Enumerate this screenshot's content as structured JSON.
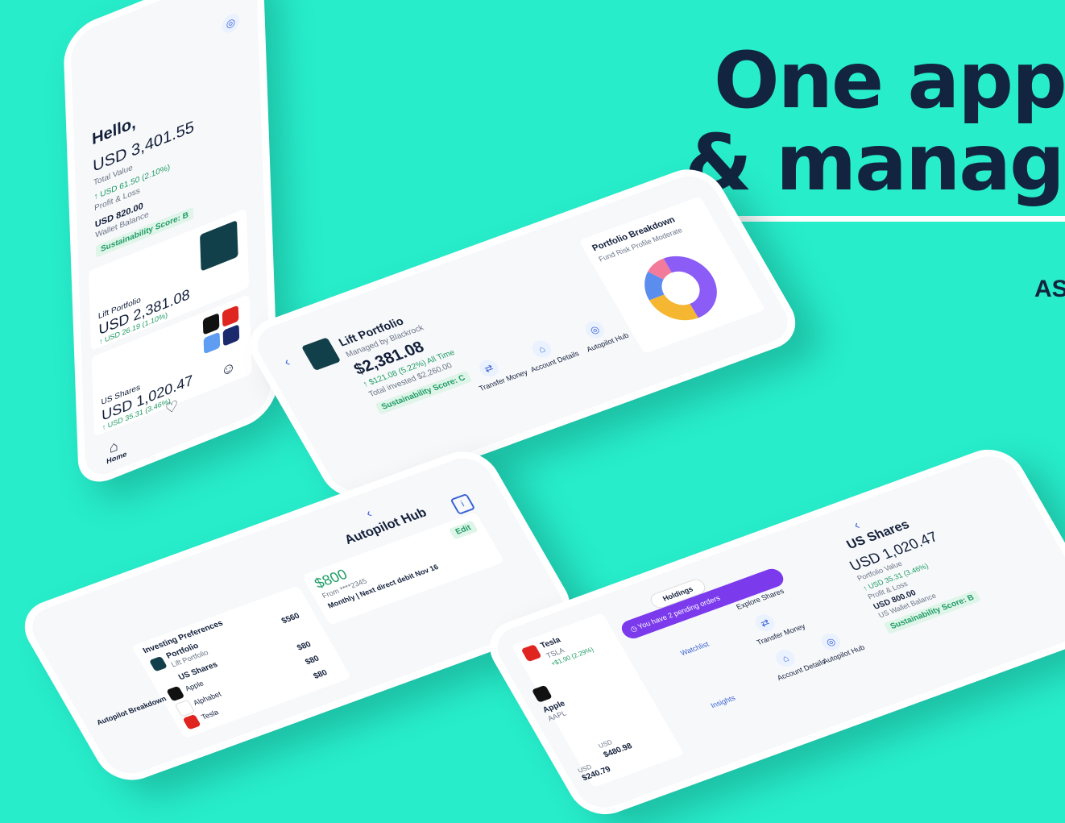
{
  "headline": {
    "line1": "One app",
    "line2": "& manag",
    "tag": "AS"
  },
  "home": {
    "app_icon": "autopilot-icon",
    "greeting": "Hello,",
    "total_value": "USD 3,401.55",
    "total_value_label": "Total Value",
    "pnl": "↑ USD 61.50 (2.10%)",
    "pnl_label": "Profit & Loss",
    "wallet": "USD 820.00",
    "wallet_label": "Wallet Balance",
    "score": "Sustainability Score: B",
    "lift_label": "Lift Portfolio",
    "lift_value": "USD 2,381.08",
    "lift_change": "↑ USD 26.19 (1.10%)",
    "us_label": "US Shares",
    "us_value": "USD 1,020.47",
    "us_change": "↑ USD 35.31 (3.46%)",
    "nav_home": "Home"
  },
  "lift": {
    "title": "Lift Portfolio",
    "managed": "Managed by Blackrock",
    "value": "$2,381.08",
    "all_time": "↑ $121.08 (5.22%) All Time",
    "invested": "Total invested $2,260.00",
    "score": "Sustainability Score: C",
    "actions": [
      "Transfer Money",
      "Account Details",
      "Autopilot Hub"
    ],
    "breakdown_title": "Portfolio Breakdown",
    "risk": "Fund Risk Profile Moderate",
    "colors": {
      "purple": "#8b5cf6",
      "yellow": "#f5b731",
      "blue": "#5b8def",
      "pink": "#f27a9a"
    }
  },
  "autopilot": {
    "title": "Autopilot Hub",
    "amount": "$800",
    "from": "From ****2345",
    "schedule": "Monthly | Next direct debit Nov 16",
    "edit": "Edit",
    "prefs_title": "Investing Preferences",
    "portfolio_label": "Portfolio",
    "lift": "Lift Portfolio",
    "lift_amt": "$560",
    "us_label": "US Shares",
    "apple": "Apple",
    "apple_amt": "$80",
    "alphabet": "Alphabet",
    "alphabet_amt": "$80",
    "tesla": "Tesla",
    "tesla_amt": "$80",
    "breakdown": "Autopilot Breakdown"
  },
  "usshares": {
    "title": "US Shares",
    "value": "USD 1,020.47",
    "value_label": "Portfolio Value",
    "pnl": "↑ USD 35.31 (3.46%)",
    "pnl_label": "Profit & Loss",
    "wallet": "USD 800.00",
    "wallet_label": "US Wallet Balance",
    "score": "Sustainability Score: B",
    "actions": [
      "Explore Shares",
      "Transfer Money",
      "Account Details",
      "Autopilot Hub"
    ],
    "tabs": [
      "Holdings",
      "Watchlist",
      "Insights"
    ],
    "pending": "You have 2 pending orders",
    "rows": [
      {
        "name": "Tesla",
        "ticker": "TSLA",
        "change": "+$1.90 (2.29%)",
        "currency": "USD",
        "price": "$480.98"
      },
      {
        "name": "Apple",
        "ticker": "AAPL",
        "change": "",
        "currency": "USD",
        "price": "$240.79"
      }
    ]
  }
}
